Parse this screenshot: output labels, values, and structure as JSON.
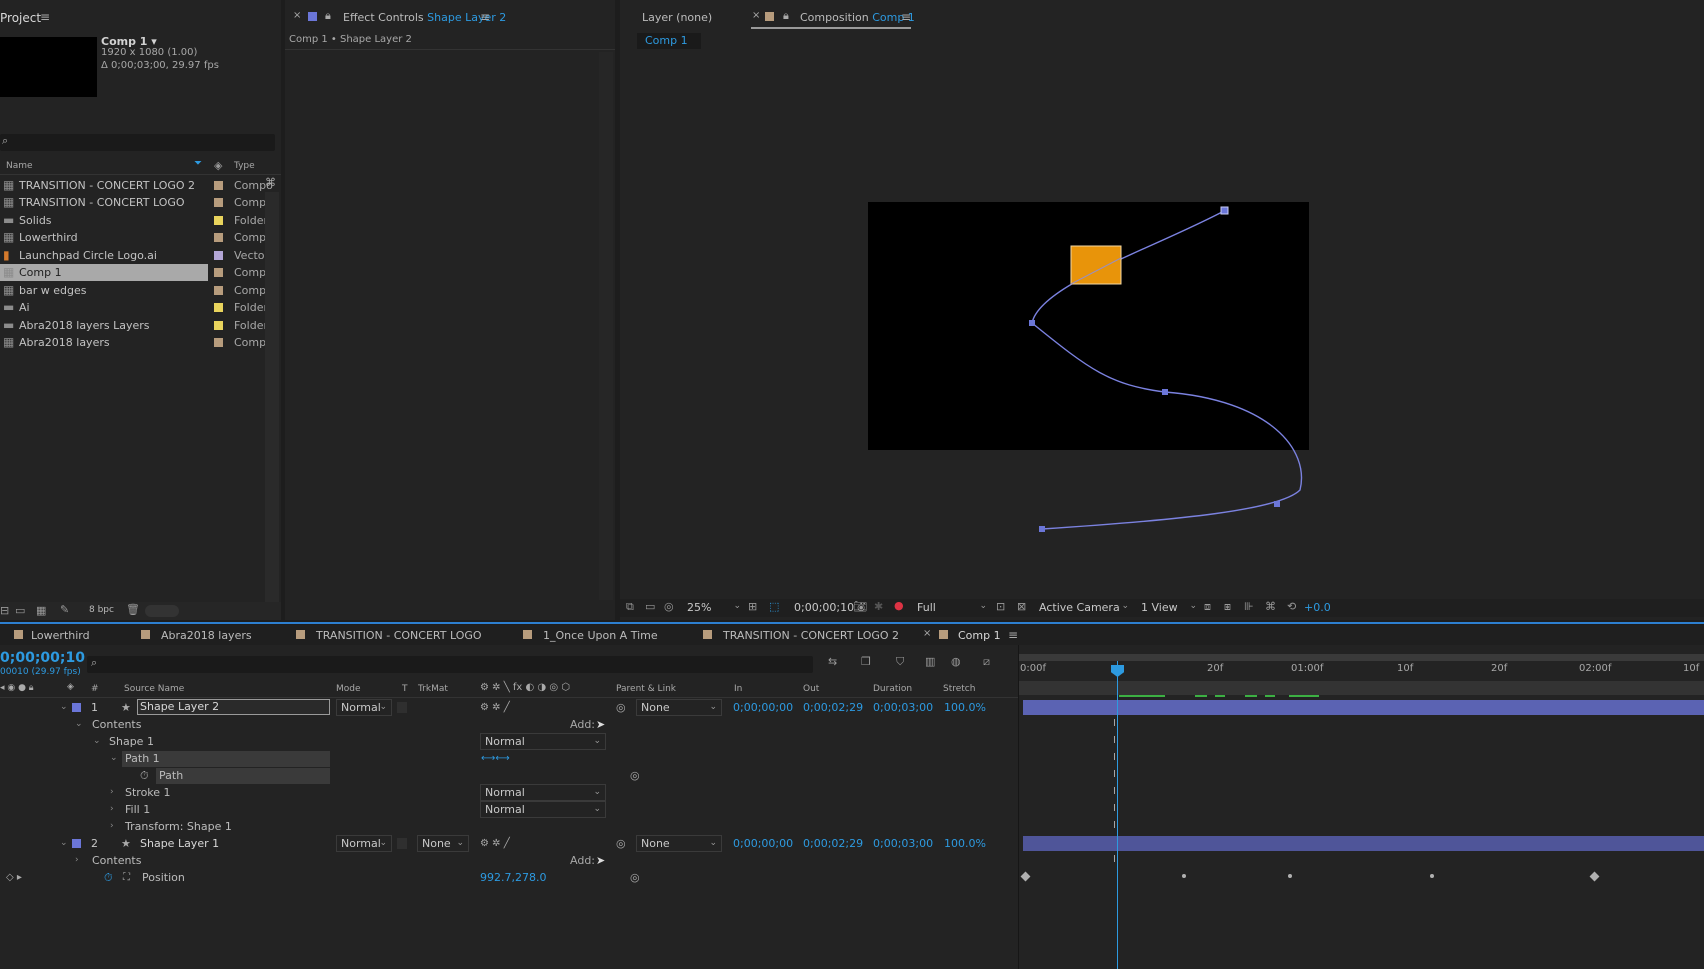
{
  "project": {
    "title": "Project",
    "comp_name": "Comp 1 ▾",
    "comp_res": "1920 x 1080 (1.00)",
    "comp_dur": "Δ 0;00;03;00, 29.97 fps",
    "col_name": "Name",
    "col_type": "Type",
    "items": [
      {
        "name": "TRANSITION - CONCERT LOGO 2",
        "type": "Compo",
        "color": "#b79c7d",
        "icon": "composition-icon"
      },
      {
        "name": "TRANSITION - CONCERT LOGO",
        "type": "Compo",
        "color": "#b79c7d",
        "icon": "composition-icon"
      },
      {
        "name": "Solids",
        "type": "Folder",
        "color": "#e9d45d",
        "icon": "folder-icon"
      },
      {
        "name": "Lowerthird",
        "type": "Compo",
        "color": "#b79c7d",
        "icon": "composition-icon"
      },
      {
        "name": "Launchpad Circle Logo.ai",
        "type": "Vector",
        "color": "#b3a6d6",
        "icon": "illustrator-file-icon"
      },
      {
        "name": "Comp 1",
        "type": "Compo",
        "color": "#b79c7d",
        "icon": "composition-icon"
      },
      {
        "name": "bar w edges",
        "type": "Compo",
        "color": "#b79c7d",
        "icon": "composition-icon"
      },
      {
        "name": "Ai",
        "type": "Folder",
        "color": "#e9d45d",
        "icon": "folder-icon"
      },
      {
        "name": "Abra2018 layers Layers",
        "type": "Folder",
        "color": "#e9d45d",
        "icon": "folder-icon"
      },
      {
        "name": "Abra2018 layers",
        "type": "Compo",
        "color": "#b79c7d",
        "icon": "composition-icon"
      }
    ],
    "bpc": "8 bpc"
  },
  "effect_controls": {
    "title": "Effect Controls",
    "layer": "Shape Layer 2",
    "breadcrumb": "Comp 1 • Shape Layer 2"
  },
  "viewer": {
    "layer_tab": "Layer (none)",
    "comp_tab_prefix": "Composition",
    "comp_tab_name": "Comp 1",
    "comp_subtab": "Comp 1",
    "zoom": "25%",
    "timecode": "0;00;00;10",
    "resolution": "Full",
    "camera": "Active Camera",
    "views": "1 View",
    "exposure": "+0.0",
    "colors": {
      "shape_fill": "#e8940a",
      "path": "#7b82e0"
    }
  },
  "timeline": {
    "tabs": [
      "Lowerthird",
      "Abra2018 layers",
      "TRANSITION - CONCERT LOGO",
      "1_Once Upon A Time",
      "TRANSITION - CONCERT LOGO 2",
      "Comp 1"
    ],
    "timecode": "0;00;00;10",
    "frames": "00010 (29.97 fps)",
    "columns": {
      "num": "#",
      "source": "Source Name",
      "mode": "Mode",
      "t": "T",
      "trkmat": "TrkMat",
      "parent": "Parent & Link",
      "in": "In",
      "out": "Out",
      "duration": "Duration",
      "stretch": "Stretch"
    },
    "ruler": [
      "0:00f",
      "20f",
      "01:00f",
      "10f",
      "20f",
      "02:00f",
      "10f"
    ],
    "layers": [
      {
        "num": "1",
        "name": "Shape Layer 2",
        "mode": "Normal",
        "trkmat": "",
        "parent": "None",
        "in": "0;00;00;00",
        "out": "0;00;02;29",
        "duration": "0;00;03;00",
        "stretch": "100.0%"
      },
      {
        "num": "2",
        "name": "Shape Layer 1",
        "mode": "Normal",
        "trkmat": "None",
        "parent": "None",
        "in": "0;00;00;00",
        "out": "0;00;02;29",
        "duration": "0;00;03;00",
        "stretch": "100.0%"
      }
    ],
    "props": {
      "contents": "Contents",
      "add": "Add:",
      "shape1": "Shape 1",
      "shape1_mode": "Normal",
      "path1": "Path 1",
      "path": "Path",
      "stroke1": "Stroke 1",
      "stroke1_mode": "Normal",
      "fill1": "Fill 1",
      "fill1_mode": "Normal",
      "transform": "Transform: Shape 1",
      "contents2": "Contents",
      "add2": "Add:",
      "position": "Position",
      "position_value": "992.7,278.0"
    },
    "colors": {
      "label": "#6b76d8",
      "bar": "#5b63b3"
    }
  }
}
